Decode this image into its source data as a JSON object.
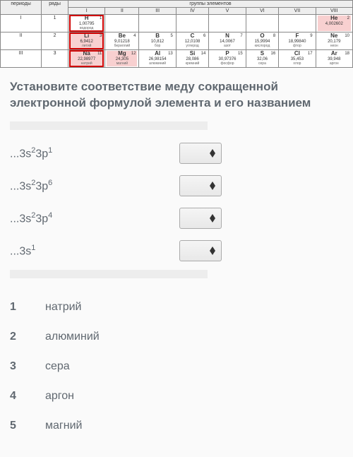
{
  "table": {
    "group_title": "группы элементов",
    "col0": "периоды",
    "col1": "ряды",
    "groups": [
      "I",
      "II",
      "III",
      "IV",
      "V",
      "VI",
      "VII",
      "VIII"
    ],
    "rows": [
      {
        "period": "I",
        "row": "1",
        "cells": [
          {
            "num": "1",
            "sym": "H",
            "mass": "1,00795",
            "name": "водород",
            "hl": true
          },
          {
            "empty": true
          },
          {
            "empty": true
          },
          {
            "empty": true
          },
          {
            "empty": true
          },
          {
            "empty": true
          },
          {
            "empty": true
          },
          {
            "num": "2",
            "sym": "He",
            "mass": "4,002602",
            "name": "",
            "pink": true
          }
        ]
      },
      {
        "period": "II",
        "row": "2",
        "cells": [
          {
            "num": "3",
            "sym": "Li",
            "mass": "6,9412",
            "name": "литий",
            "pink": true,
            "hl": true
          },
          {
            "num": "4",
            "sym": "Be",
            "mass": "9,01218",
            "name": "бериллий"
          },
          {
            "num": "5",
            "sym": "B",
            "mass": "10,812",
            "name": "бор"
          },
          {
            "num": "6",
            "sym": "C",
            "mass": "12,0108",
            "name": "углерод"
          },
          {
            "num": "7",
            "sym": "N",
            "mass": "14,0067",
            "name": "азот"
          },
          {
            "num": "8",
            "sym": "O",
            "mass": "15,9994",
            "name": "кислород"
          },
          {
            "num": "9",
            "sym": "F",
            "mass": "18,99840",
            "name": "фтор"
          },
          {
            "num": "10",
            "sym": "Ne",
            "mass": "20,179",
            "name": "неон"
          }
        ]
      },
      {
        "period": "III",
        "row": "3",
        "cells": [
          {
            "num": "11",
            "sym": "Na",
            "mass": "22,98977",
            "name": "натрий",
            "pink": true,
            "hl": true
          },
          {
            "num": "12",
            "sym": "Mg",
            "mass": "24,305",
            "name": "магний",
            "pink": true
          },
          {
            "num": "13",
            "sym": "Al",
            "mass": "26,98154",
            "name": "алюминий"
          },
          {
            "num": "14",
            "sym": "Si",
            "mass": "28,086",
            "name": "кремний"
          },
          {
            "num": "15",
            "sym": "P",
            "mass": "30,97376",
            "name": "фосфор"
          },
          {
            "num": "16",
            "sym": "S",
            "mass": "32,06",
            "name": "сера"
          },
          {
            "num": "17",
            "sym": "Cl",
            "mass": "35,453",
            "name": "хлор"
          },
          {
            "num": "18",
            "sym": "Ar",
            "mass": "39,948",
            "name": "аргон"
          }
        ]
      }
    ]
  },
  "question": "Установите соответствие меду сокращенной электронной формулой элемента и его названием",
  "formulas": [
    {
      "pre": "...3s",
      "sup1": "2",
      "mid": "3p",
      "sup2": "1"
    },
    {
      "pre": "...3s",
      "sup1": "2",
      "mid": "3p",
      "sup2": "6"
    },
    {
      "pre": "...3s",
      "sup1": "2",
      "mid": "3p",
      "sup2": "4"
    },
    {
      "pre": "...3s",
      "sup1": "1",
      "mid": "",
      "sup2": ""
    }
  ],
  "answers": [
    {
      "n": "1",
      "label": "натрий"
    },
    {
      "n": "2",
      "label": "алюминий"
    },
    {
      "n": "3",
      "label": "сера"
    },
    {
      "n": "4",
      "label": "аргон"
    },
    {
      "n": "5",
      "label": "магний"
    }
  ]
}
